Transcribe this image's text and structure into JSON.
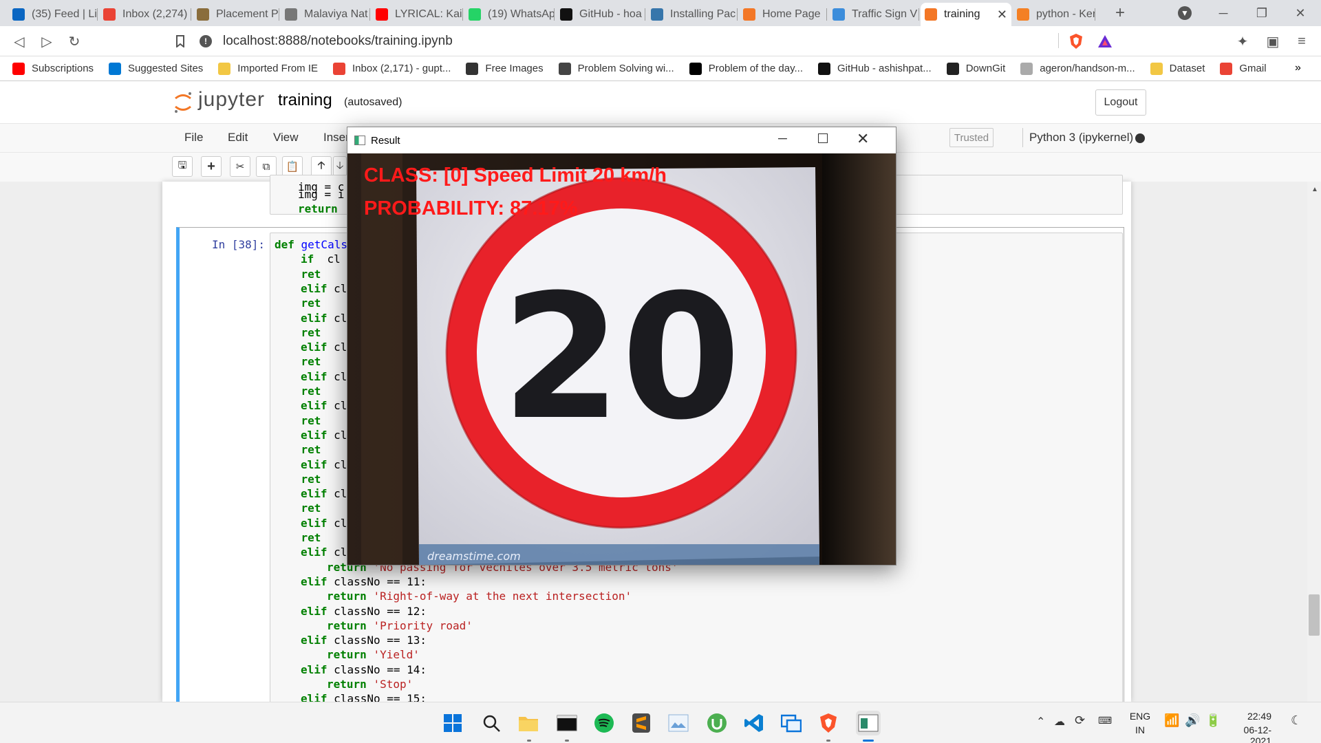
{
  "browser": {
    "tabs": [
      {
        "label": "(35) Feed | Li",
        "icon": "linkedin-icon",
        "color": "#0a66c2"
      },
      {
        "label": "Inbox (2,274)",
        "icon": "gmail-icon",
        "color": "#ea4335"
      },
      {
        "label": "Placement Pc",
        "icon": "globe-icon",
        "color": "#8a6d3b"
      },
      {
        "label": "Malaviya Nat",
        "icon": "circle-icon",
        "color": "#777777"
      },
      {
        "label": "LYRICAL: Kais",
        "icon": "youtube-icon",
        "color": "#ff0000"
      },
      {
        "label": "(19) WhatsAp",
        "icon": "whatsapp-icon",
        "color": "#25d366"
      },
      {
        "label": "GitHub - hoa",
        "icon": "github-icon",
        "color": "#111111"
      },
      {
        "label": "Installing Pac",
        "icon": "python-icon",
        "color": "#3776ab"
      },
      {
        "label": "Home Page",
        "icon": "jupyter-icon",
        "color": "#f37726"
      },
      {
        "label": "Traffic Sign V",
        "icon": "vscode-icon",
        "color": "#3c8ddb"
      },
      {
        "label": "training",
        "icon": "hourglass-icon",
        "color": "#f37726"
      },
      {
        "label": "python - Ker",
        "icon": "stackoverflow-icon",
        "color": "#f48024"
      }
    ],
    "new_tab_glyph": "+",
    "url": "localhost:8888/notebooks/training.ipynb",
    "bookmarks": [
      {
        "label": "Subscriptions",
        "color": "#ff0000",
        "icon": "youtube-icon"
      },
      {
        "label": "Suggested Sites",
        "color": "#0078d4",
        "icon": "bing-icon"
      },
      {
        "label": "Imported From IE",
        "color": "#f2c744",
        "icon": "folder-icon"
      },
      {
        "label": "Inbox (2,171) - gupt...",
        "color": "#ea4335",
        "icon": "gmail-icon"
      },
      {
        "label": "Free Images",
        "color": "#333333",
        "icon": "tks-icon"
      },
      {
        "label": "Problem Solving wi...",
        "color": "#444444",
        "icon": "book-icon"
      },
      {
        "label": "Problem of the day...",
        "color": "#000000",
        "icon": "square-icon"
      },
      {
        "label": "GitHub - ashishpat...",
        "color": "#111111",
        "icon": "github-icon"
      },
      {
        "label": "DownGit",
        "color": "#222222",
        "icon": "downgit-icon"
      },
      {
        "label": "ageron/handson-m...",
        "color": "#aaaaaa",
        "icon": "github-icon"
      },
      {
        "label": "Dataset",
        "color": "#f2c744",
        "icon": "folder-icon"
      },
      {
        "label": "Gmail",
        "color": "#ea4335",
        "icon": "gmail-icon"
      }
    ],
    "bookmarks_more": "»"
  },
  "jupyter": {
    "logo_text": "jupyter",
    "notebook_name": "training",
    "autosave": "(autosaved)",
    "logout": "Logout",
    "menus": [
      "File",
      "Edit",
      "View",
      "Inser"
    ],
    "trusted": "Trusted",
    "kernel": "Python 3 (ipykernel)",
    "cell_prompt": "In [38]:",
    "prev_cell_lines": [
      "img = c",
      "img = i",
      "return"
    ],
    "code": {
      "def_line": "getCals",
      "lines": [
        {
          "kw": "if",
          "rest": "  cl"
        },
        {
          "kw": "",
          "rest": "    ret"
        },
        {
          "kw": "elif",
          "rest": " cl"
        },
        {
          "kw": "",
          "rest": "    ret"
        },
        {
          "kw": "elif",
          "rest": " cl"
        },
        {
          "kw": "",
          "rest": "    ret"
        },
        {
          "kw": "elif",
          "rest": " cl"
        },
        {
          "kw": "",
          "rest": "    ret"
        },
        {
          "kw": "elif",
          "rest": " cl"
        },
        {
          "kw": "",
          "rest": "    ret"
        },
        {
          "kw": "elif",
          "rest": " cl"
        },
        {
          "kw": "",
          "rest": "    ret"
        },
        {
          "kw": "elif",
          "rest": " cl"
        },
        {
          "kw": "",
          "rest": "    ret"
        },
        {
          "kw": "elif",
          "rest": " cl"
        },
        {
          "kw": "",
          "rest": "    ret"
        },
        {
          "kw": "elif",
          "rest": " cl"
        },
        {
          "kw": "",
          "rest": "    ret"
        },
        {
          "kw": "elif",
          "rest": " cl"
        },
        {
          "kw": "",
          "rest": "    ret"
        },
        {
          "kw": "elif",
          "rest": " cl"
        }
      ],
      "tail": [
        {
          "kw": "return",
          "str": "'No passing for vechiles over 3.5 metric tons'",
          "indent": 2,
          "partial": true
        },
        {
          "kw": "elif",
          "cond": "classNo == 11:",
          "indent": 1
        },
        {
          "kw": "return",
          "str": "'Right-of-way at the next intersection'",
          "indent": 2
        },
        {
          "kw": "elif",
          "cond": "classNo == 12:",
          "indent": 1
        },
        {
          "kw": "return",
          "str": "'Priority road'",
          "indent": 2
        },
        {
          "kw": "elif",
          "cond": "classNo == 13:",
          "indent": 1
        },
        {
          "kw": "return",
          "str": "'Yield'",
          "indent": 2
        },
        {
          "kw": "elif",
          "cond": "classNo == 14:",
          "indent": 1
        },
        {
          "kw": "return",
          "str": "'Stop'",
          "indent": 2
        },
        {
          "kw": "elif",
          "cond": "classNo == 15:",
          "indent": 1
        }
      ]
    }
  },
  "result_window": {
    "title": "Result",
    "class_text": "CLASS:  [0] Speed Limit 20 km/h",
    "probability_text": "PROBABILITY: 87.17%",
    "sign_number": "20",
    "watermark": "dreamstime.com",
    "overlay_color": "#ff1a1a"
  },
  "taskbar": {
    "apps": [
      "start-icon",
      "search-icon",
      "file-explorer-icon",
      "terminal-icon",
      "spotify-icon",
      "sublime-icon",
      "photos-icon",
      "utorrent-icon",
      "vscode-icon",
      "screen-share-icon",
      "brave-icon",
      "result-window-icon"
    ],
    "lang_top": "ENG",
    "lang_bottom": "IN",
    "time": "22:49",
    "date": "06-12-2021"
  }
}
